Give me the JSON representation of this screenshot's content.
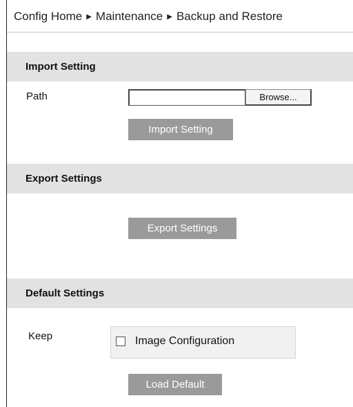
{
  "breadcrumb": {
    "items": [
      "Config Home",
      "Maintenance",
      "Backup and Restore"
    ],
    "separator": "▶"
  },
  "import_section": {
    "title": "Import Setting",
    "path_label": "Path",
    "path_value": "",
    "browse_label": "Browse...",
    "import_button": "Import Setting"
  },
  "export_section": {
    "title": "Export Settings",
    "export_button": "Export Settings"
  },
  "default_section": {
    "title": "Default Settings",
    "keep_label": "Keep",
    "image_config_label": "Image Configuration",
    "image_config_checked": false,
    "load_default_button": "Load Default"
  },
  "colors": {
    "header_bg": "#e2e2e2",
    "button_bg": "#9a9a9a",
    "button_text": "#ffffff"
  }
}
